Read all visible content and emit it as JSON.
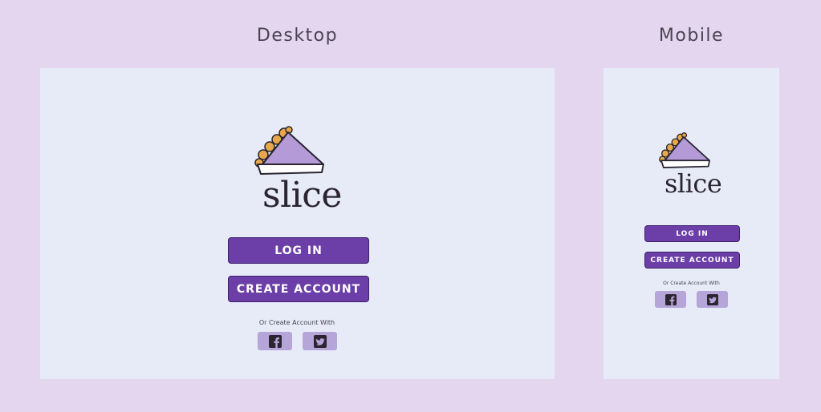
{
  "labels": {
    "desktop": "Desktop",
    "mobile": "Mobile"
  },
  "brand": {
    "name": "slice"
  },
  "buttons": {
    "login": "LOG IN",
    "create_account": "CREATE ACCOUNT"
  },
  "social": {
    "prompt": "Or Create Account With",
    "facebook_icon": "facebook-icon",
    "twitter_icon": "twitter-icon"
  },
  "colors": {
    "background": "#e5d6ef",
    "frame": "#e7ebf8",
    "button": "#6c3fa8",
    "social_button": "#b6a5d8",
    "pie_filling": "#b49ad6",
    "pie_crust": "#e8a84a"
  }
}
